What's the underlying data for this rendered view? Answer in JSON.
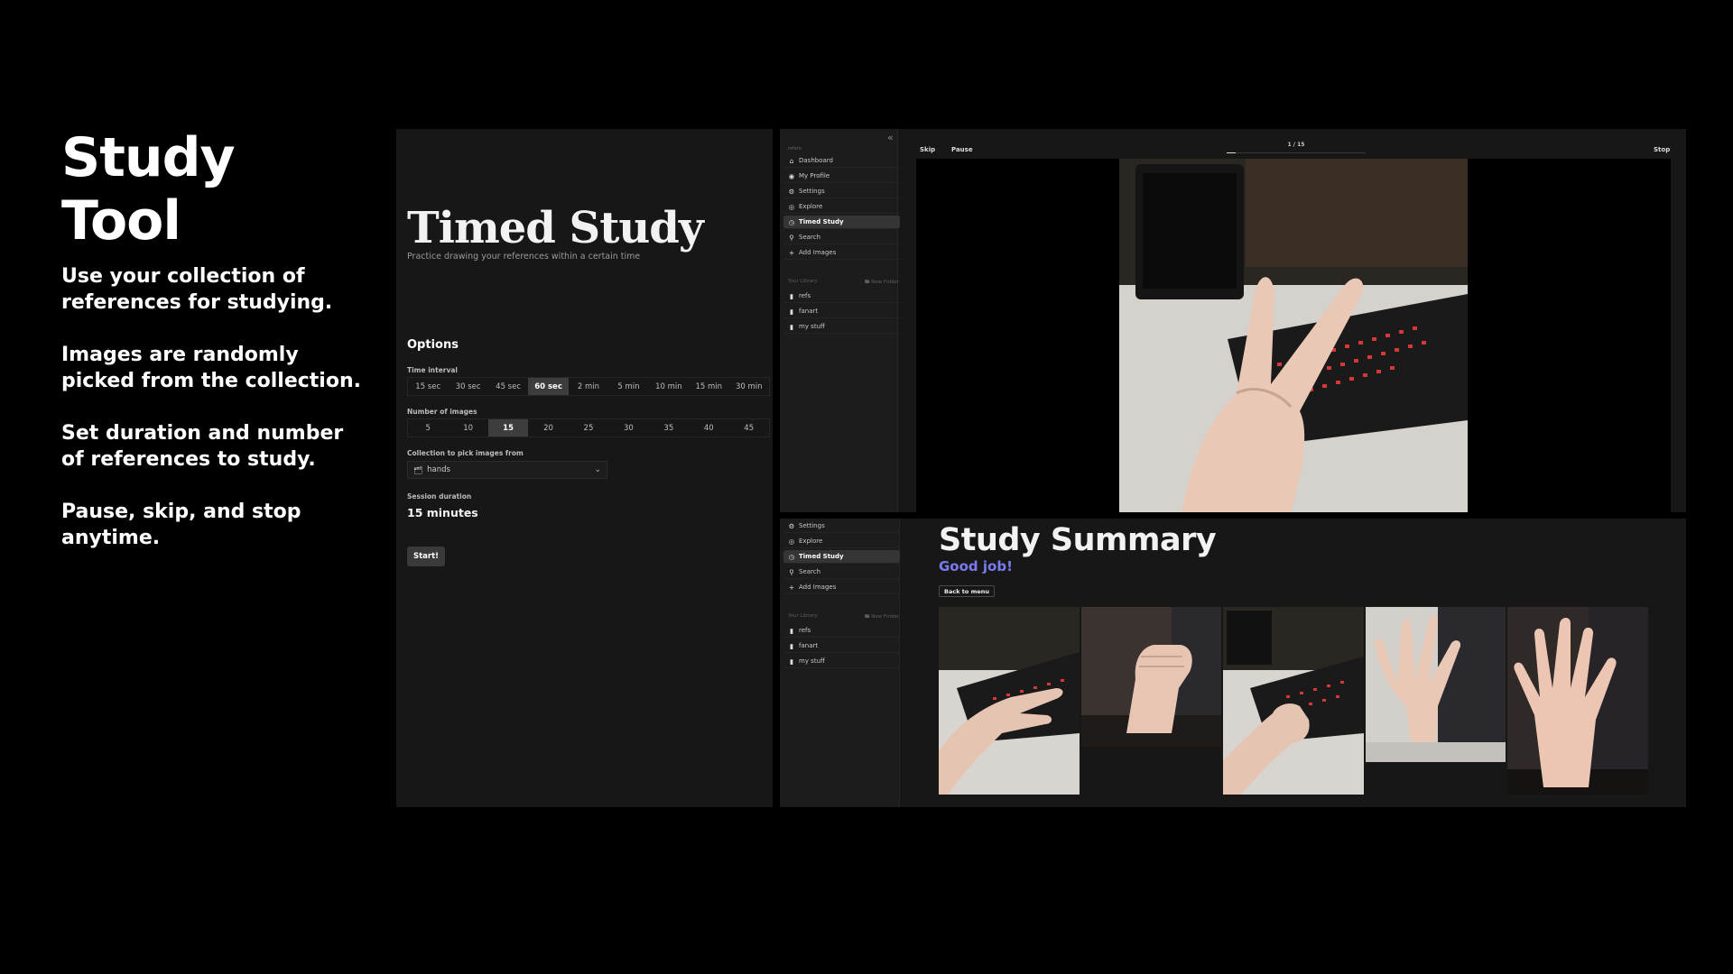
{
  "intro": {
    "title": "Study Tool",
    "p1": "Use your collection of references for studying.",
    "p2": "Images are randomly picked from the collection.",
    "p3": "Set duration and number of references to study.",
    "p4": "Pause, skip, and stop anytime."
  },
  "setup": {
    "title": "Timed Study",
    "subtitle": "Practice drawing your references within a certain time",
    "options_heading": "Options",
    "interval_label": "Time interval",
    "intervals": [
      "15 sec",
      "30 sec",
      "45 sec",
      "60 sec",
      "2 min",
      "5 min",
      "10 min",
      "15 min",
      "30 min"
    ],
    "interval_selected": "60 sec",
    "count_label": "Number of images",
    "counts": [
      "5",
      "10",
      "15",
      "20",
      "25",
      "30",
      "35",
      "40",
      "45"
    ],
    "count_selected": "15",
    "collection_label": "Collection to pick images from",
    "collection_value": "hands",
    "duration_label": "Session duration",
    "duration_value": "15 minutes",
    "start_label": "Start!"
  },
  "sidebar": {
    "app_name": "refero",
    "collapse_icon": "double-chevron-left-icon",
    "nav": [
      {
        "label": "Dashboard",
        "icon": "home-icon"
      },
      {
        "label": "My Profile",
        "icon": "user-icon"
      },
      {
        "label": "Settings",
        "icon": "gear-icon"
      },
      {
        "label": "Explore",
        "icon": "compass-icon"
      },
      {
        "label": "Timed Study",
        "icon": "clock-icon"
      },
      {
        "label": "Search",
        "icon": "search-icon"
      },
      {
        "label": "Add Images",
        "icon": "plus-icon"
      }
    ],
    "active": "Timed Study",
    "library_label": "Your Library",
    "new_folder_label": "New Folder",
    "folders": [
      "refs",
      "fanart",
      "my stuff"
    ]
  },
  "session": {
    "skip_label": "Skip",
    "pause_label": "Pause",
    "progress": "1 / 15",
    "progress_fraction": 0.067,
    "stop_label": "Stop"
  },
  "summary": {
    "title": "Study Summary",
    "subtitle": "Good job!",
    "back_label": "Back to menu",
    "accent": "#7b7bf0"
  }
}
